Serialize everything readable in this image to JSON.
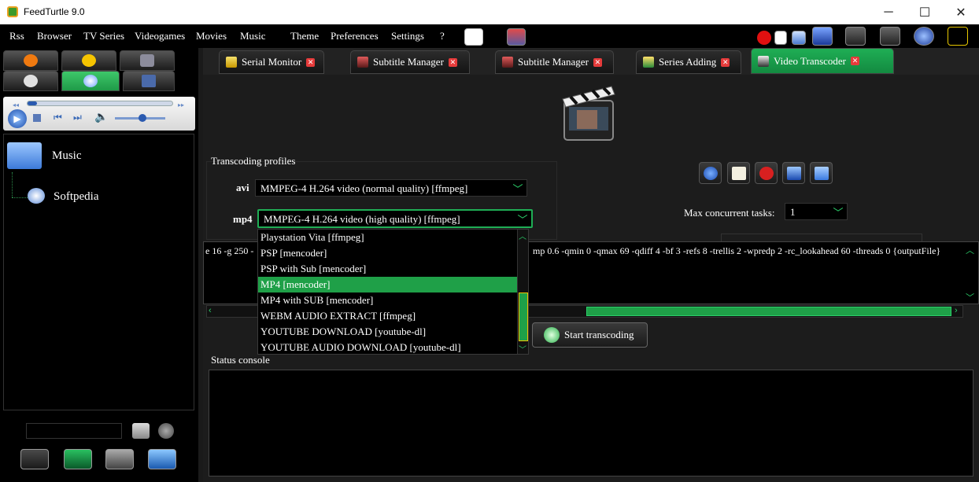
{
  "window": {
    "title": "FeedTurtle 9.0",
    "minimize": "─",
    "maximize": "☐",
    "close": "✕"
  },
  "menu": [
    "Rss",
    "Browser",
    "TV Series",
    "Videogames",
    "Movies",
    "Music",
    "Theme",
    "Preferences",
    "Settings",
    "?"
  ],
  "toolbar_icons": [
    "dollar-shield-icon",
    "magnet-icon",
    "red-dot-icon",
    "page-icon",
    "envelope-icon",
    "bookmark-icon",
    "speaker-icon",
    "film-icon",
    "globe-icon",
    "expand-icon"
  ],
  "left_tabs": [
    "rss-icon",
    "star-icon",
    "pictures-icon",
    "film-reel-icon",
    "music-disc-icon",
    "monitor-icon"
  ],
  "tree": {
    "root": "Music",
    "child": "Softpedia"
  },
  "tabs": [
    {
      "label": "Serial Monitor"
    },
    {
      "label": "Subtitle Manager"
    },
    {
      "label": "Subtitle Manager"
    },
    {
      "label": "Series Adding"
    },
    {
      "label": "Video Transcoder"
    }
  ],
  "transcoder": {
    "section_label": "Transcoding profiles",
    "avi_label": "avi",
    "avi_value": "MMPEG-4 H.264 video (normal quality) [ffmpeg]",
    "mp4_label": "mp4",
    "mp4_value": "MMPEG-4 H.264 video (high quality) [ffmpeg]",
    "max_tasks_label": "Max concurrent tasks:",
    "max_tasks_value": "1",
    "command_left": "e 16 -g 250 -",
    "command_right": "mp 0.6 -qmin 0 -qmax 69 -qdiff 4 -bf 3 -refs 8 -trellis 2 -wpredp 2 -rc_lookahead 60 -threads 0 {outputFile}",
    "start_button": "Start transcoding",
    "status_label": "Status console"
  },
  "dropdown_options": [
    "Playstation Vita [ffmpeg]",
    "PSP [mencoder]",
    "PSP with Sub [mencoder]",
    "MP4 [mencoder]",
    "MP4 with SUB [mencoder]",
    "WEBM AUDIO EXTRACT [ffmpeg]",
    "YOUTUBE DOWNLOAD [youtube-dl]",
    "YOUTUBE AUDIO DOWNLOAD [youtube-dl]"
  ],
  "dropdown_selected_index": 3,
  "player": {
    "volume_level": 0.55,
    "progress": 0.0
  },
  "colors": {
    "accent": "#1fae55",
    "highlight": "#1fa048",
    "background": "#1c1c1c"
  }
}
